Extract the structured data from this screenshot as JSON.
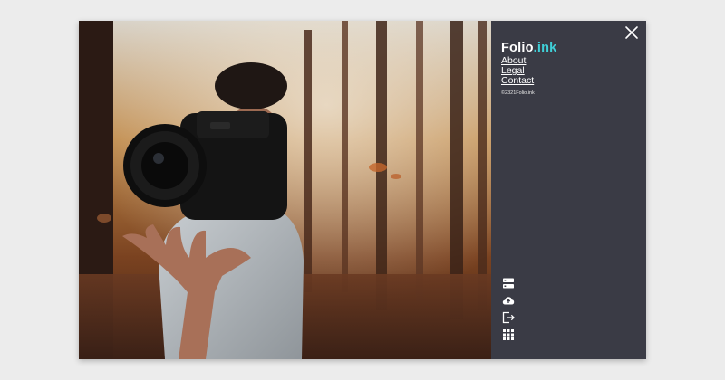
{
  "brand": {
    "main": "Folio",
    "accent": ".ink",
    "accent_color": "#3fd0d8"
  },
  "nav": {
    "items": [
      "About",
      "Legal",
      "Contact"
    ]
  },
  "copyright": "©2321Folio.ink",
  "panel": {
    "background": "#3a3b45"
  },
  "icons": [
    "close-icon",
    "server-icon",
    "cloud-upload-icon",
    "logout-icon",
    "apps-grid-icon"
  ]
}
